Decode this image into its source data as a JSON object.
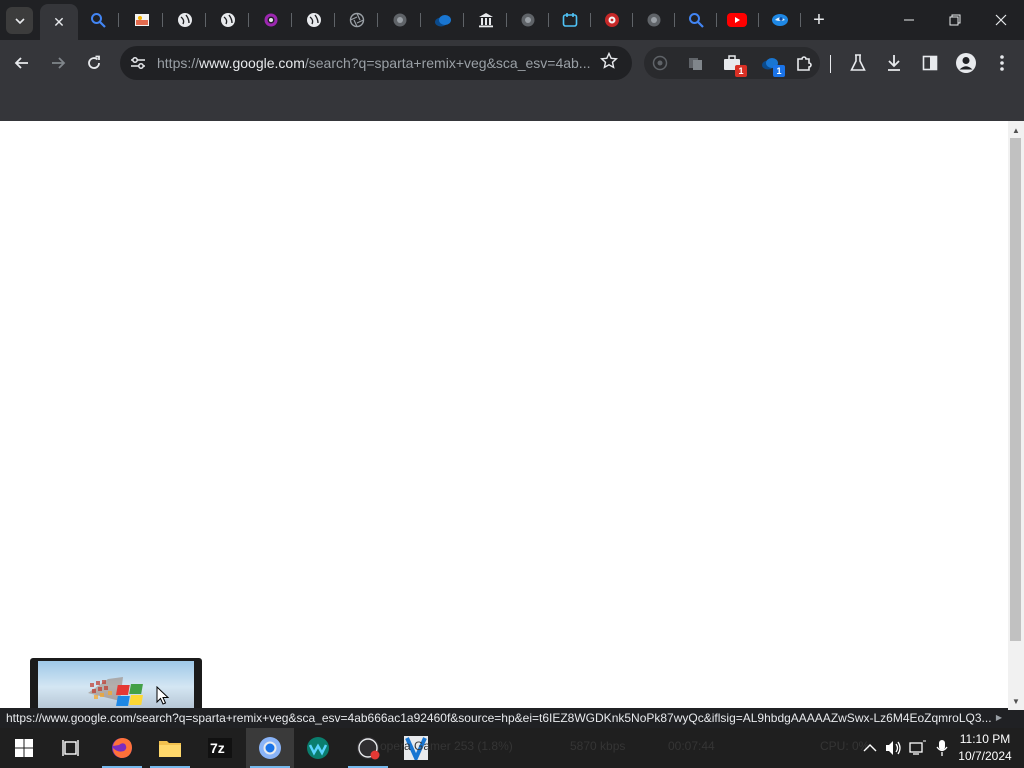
{
  "browser": {
    "tabs": [
      {
        "name": "tab-magnify",
        "icon": "magnifier-icon"
      },
      {
        "name": "tab-image",
        "icon": "image-icon"
      },
      {
        "name": "tab-globe-1",
        "icon": "globe-icon"
      },
      {
        "name": "tab-globe-2",
        "icon": "globe-icon"
      },
      {
        "name": "tab-ring",
        "icon": "ring-icon"
      },
      {
        "name": "tab-globe-3",
        "icon": "globe-icon"
      },
      {
        "name": "tab-aperture-1",
        "icon": "aperture-icon"
      },
      {
        "name": "tab-aperture-2",
        "icon": "aperture-icon"
      },
      {
        "name": "tab-cloud",
        "icon": "cloud-icon"
      },
      {
        "name": "tab-bank",
        "icon": "bank-icon"
      },
      {
        "name": "tab-aperture-3",
        "icon": "aperture-icon"
      },
      {
        "name": "tab-calendar",
        "icon": "calendar-icon"
      },
      {
        "name": "tab-disc",
        "icon": "disc-icon"
      },
      {
        "name": "tab-aperture-4",
        "icon": "aperture-icon"
      },
      {
        "name": "tab-search",
        "icon": "search-icon"
      },
      {
        "name": "tab-youtube",
        "icon": "youtube-icon"
      },
      {
        "name": "tab-eye",
        "icon": "eye-icon"
      }
    ],
    "active_tab_close": "✕",
    "new_tab": "+",
    "omnibox": {
      "prefix": "https://",
      "host": "www.google.com",
      "path": "/search?q=sparta+remix+veg&sca_esv=4ab..."
    },
    "extensions": [
      {
        "name": "ext-record",
        "badge": ""
      },
      {
        "name": "ext-copy",
        "badge": ""
      },
      {
        "name": "ext-briefcase",
        "badge": "1",
        "badge_color": "#d93025"
      },
      {
        "name": "ext-cloud",
        "badge": "1",
        "badge_color": "#1a73e8"
      },
      {
        "name": "ext-puzzle",
        "badge": ""
      }
    ],
    "status_url": "https://www.google.com/search?q=sparta+remix+veg&sca_esv=4ab666ac1a92460f&source=hp&ei=t6IEZ8WGDKnk5NoPk87wyQc&iflsig=AL9hbdgAAAAAZwSwx-Lz6M4EoZqmroLQ3..."
  },
  "taskbar": {
    "apps": [
      "start",
      "task-view",
      "firefox",
      "file-explorer",
      "7zip",
      "chrome",
      "webex",
      "obs",
      "vs-code"
    ],
    "ghost_texts": [
      "opera Gamer 253 (1.8%)",
      "5870 kbps",
      "00:07:44",
      "CPU: 0%"
    ],
    "clock": {
      "time": "11:10 PM",
      "date": "10/7/2024"
    }
  },
  "colors": {
    "accent": "#8ab4f8",
    "youtube": "#ff0000",
    "taskbar_indicator": "#76b9ed"
  }
}
